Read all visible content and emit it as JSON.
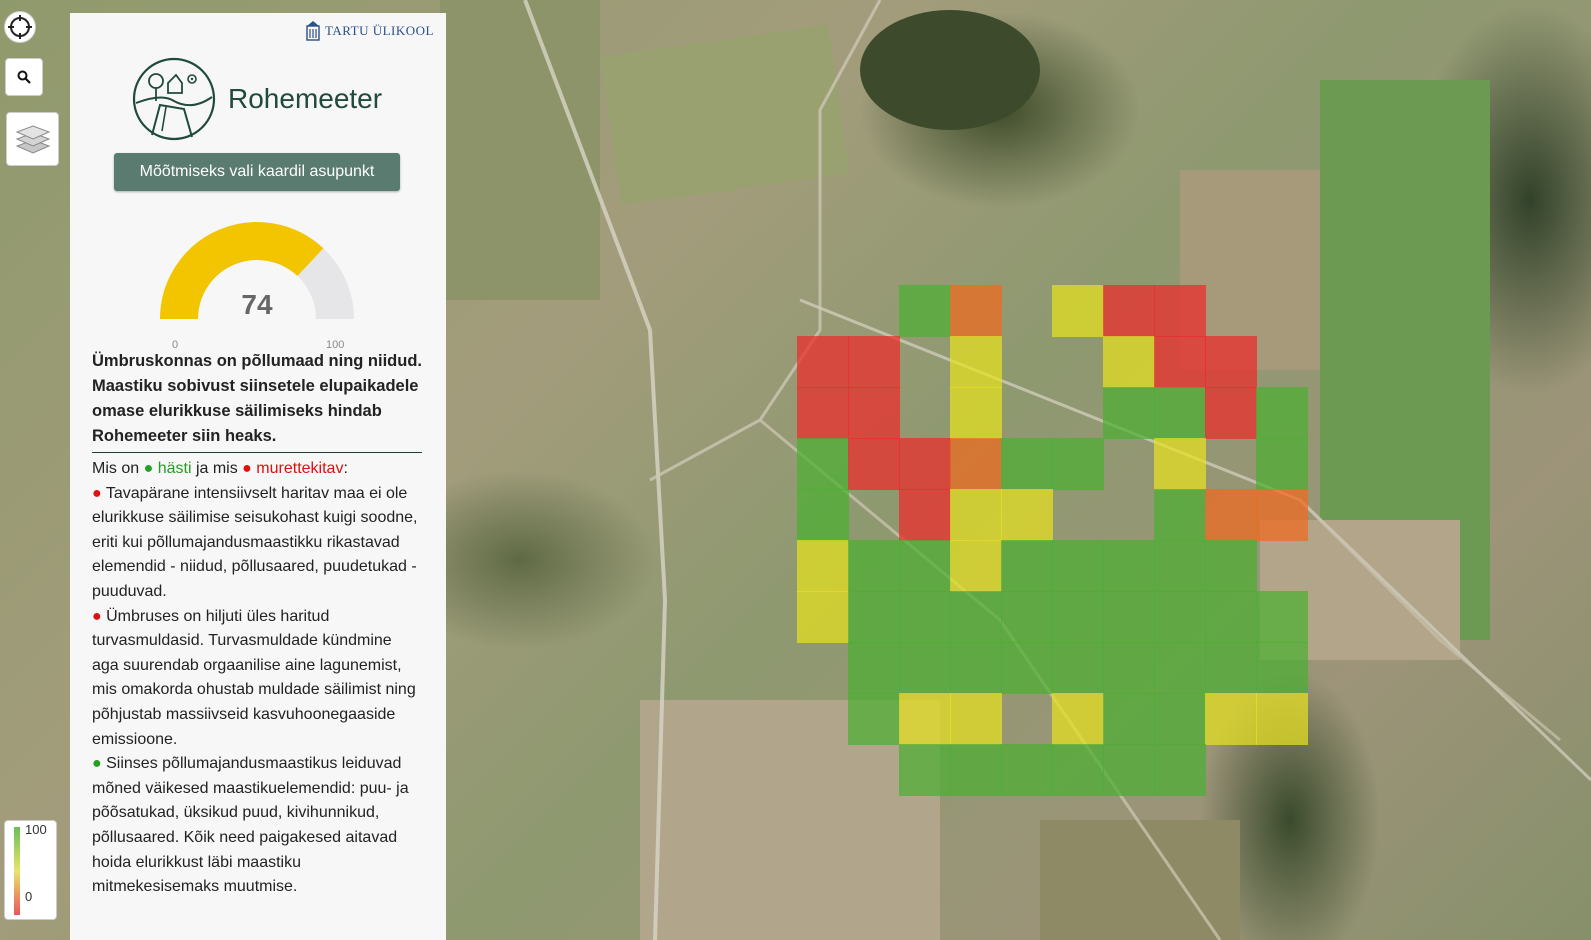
{
  "university": {
    "name": "TARTU ÜLIKOOL"
  },
  "app": {
    "title": "Rohemeeter"
  },
  "controls": {
    "locate_icon": "crosshair-icon",
    "search_icon": "search-icon",
    "layers_icon": "layers-icon"
  },
  "measure_button": {
    "label": "Mõõtmiseks vali kaardil asupunkt"
  },
  "gauge": {
    "value": 74,
    "value_label": "74",
    "min_label": "0",
    "max_label": "100",
    "color_fill": "#f2c500",
    "color_track": "#e6e6e9"
  },
  "summary": "Ümbruskonnas on põllumaad ning niidud. Maastiku sobivust siinsetele elupaikadele omase elurikkuse säilimiseks hindab Rohemeeter siin heaks.",
  "legend_line": {
    "prefix": "Mis on ",
    "dot": "●",
    "good": "hästi",
    "middle": " ja mis ",
    "bad": "murettekitav",
    "suffix": ":"
  },
  "items": [
    {
      "dot": "●",
      "status": "bad",
      "text": "Tavapärane intensiivselt haritav maa ei ole elurikkuse säilimise seisukohast kuigi soodne, eriti kui põllumajandusmaastikku rikastavad elemendid - niidud, põllusaared, puudetukad - puuduvad."
    },
    {
      "dot": "●",
      "status": "bad",
      "text": "Ümbruses on hiljuti üles haritud turvasmuldasid. Turvasmuldade kündmine aga suurendab orgaanilise aine lagunemist, mis omakorda ohustab muldade säilimist ning põhjustab massiivseid kasvuhoonegaaside emissioone."
    },
    {
      "dot": "●",
      "status": "good",
      "text": "Siinses põllumajandusmaastikus leiduvad mõned väikesed maastikuelemendid: puu- ja põõsatukad, üksikud puud, kivihunnikud, põllusaared. Kõik need paigakesed aitavad hoida elurikkust läbi maastiku mitmekesisemaks muutmise."
    }
  ],
  "map_legend": {
    "max_label": "100",
    "min_label": "0"
  },
  "heatmap": {
    "colors": {
      "g": "#4caf32",
      "y": "#e6e020",
      "o": "#f06a1e",
      "r": "#ee2a2a"
    },
    "grid": [
      "..go.yrr..",
      "rr.y..yrr.",
      "rr.y..ggrg",
      "grrogg.y.g",
      "g.ryy..goo",
      "yggyggggg.",
      "yggggggggg",
      ".ggggggggg",
      ".gyy.yggyy",
      "..gggggg.."
    ]
  }
}
